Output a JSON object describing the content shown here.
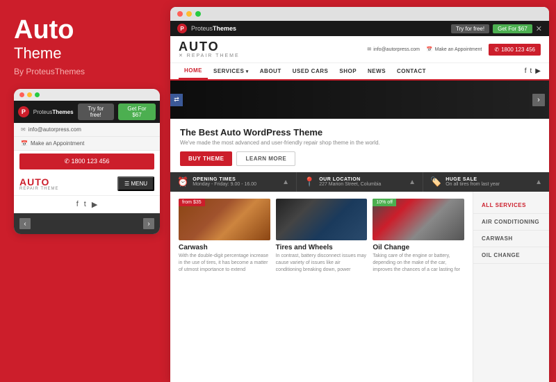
{
  "left": {
    "title": "Auto",
    "subtitle": "Theme",
    "by": "By ProteusThemes"
  },
  "mobile": {
    "p_icon": "P",
    "try_btn": "Try for free!",
    "get_btn": "Get For $67",
    "email": "info@autorpress.com",
    "appointment": "Make an Appointment",
    "phone": "✆  1800 123 456",
    "auto_text": "AUTO",
    "repair_text": "REPAIR THEME",
    "menu_btn": "☰  MENU",
    "social_fb": "f",
    "social_tw": "t",
    "social_yt": "▶"
  },
  "browser": {
    "p_icon": "P",
    "brand": "Proteus",
    "brand_bold": "Themes",
    "try_btn": "Try for free!",
    "get_btn": "Get For $67",
    "close": "✕"
  },
  "site_header": {
    "auto_text": "AUTO",
    "repair_text": "✕  REPAIR THEME",
    "email_icon": "✉",
    "email": "info@autorpress.com",
    "appt_icon": "📅",
    "appt": "Make an Appointment",
    "phone_icon": "✆",
    "phone": "1800 123 456"
  },
  "nav": {
    "items": [
      {
        "label": "HOME",
        "active": true
      },
      {
        "label": "SERVICES",
        "active": false
      },
      {
        "label": "ABOUT",
        "active": false
      },
      {
        "label": "USED CARS",
        "active": false
      },
      {
        "label": "SHOP",
        "active": false
      },
      {
        "label": "NEWS",
        "active": false
      },
      {
        "label": "CONTACT",
        "active": false
      }
    ],
    "social": [
      "f",
      "t",
      "▶"
    ]
  },
  "cta": {
    "heading": "The Best Auto WordPress Theme",
    "sub": "We've made the most advanced and user-friendly repair shop theme in the world.",
    "buy_btn": "BUY THEME",
    "learn_btn": "LEARN MORE"
  },
  "info_bar": [
    {
      "icon": "⏰",
      "label": "OPENING TIMES",
      "value": "Monday - Friday: 9.00 - 16.00"
    },
    {
      "icon": "📍",
      "label": "OUR LOCATION",
      "value": "227 Marion Street, Columbia"
    },
    {
      "icon": "🏷️",
      "label": "HUGE SALE",
      "value": "On all tires from last year"
    }
  ],
  "services": [
    {
      "badge": "from $35",
      "badge_color": "red",
      "title": "Carwash",
      "desc": "With the double-digit percentage increase in the use of tires, it has become a matter of utmost importance to extend"
    },
    {
      "badge": "",
      "badge_color": "",
      "title": "Tires and Wheels",
      "desc": "In contrast, battery disconnect issues may cause variety of issues like air conditioning breaking down, power"
    },
    {
      "badge": "10% off",
      "badge_color": "green",
      "title": "Oil Change",
      "desc": "Taking care of the engine or battery, depending on the make of the car, improves the chances of a car lasting for"
    }
  ],
  "sidebar_menu": [
    {
      "label": "ALL SERVICES",
      "active": true
    },
    {
      "label": "AIR CONDITIONING",
      "active": false
    },
    {
      "label": "CARWASH",
      "active": false
    },
    {
      "label": "OIL CHANGE",
      "active": false
    }
  ]
}
